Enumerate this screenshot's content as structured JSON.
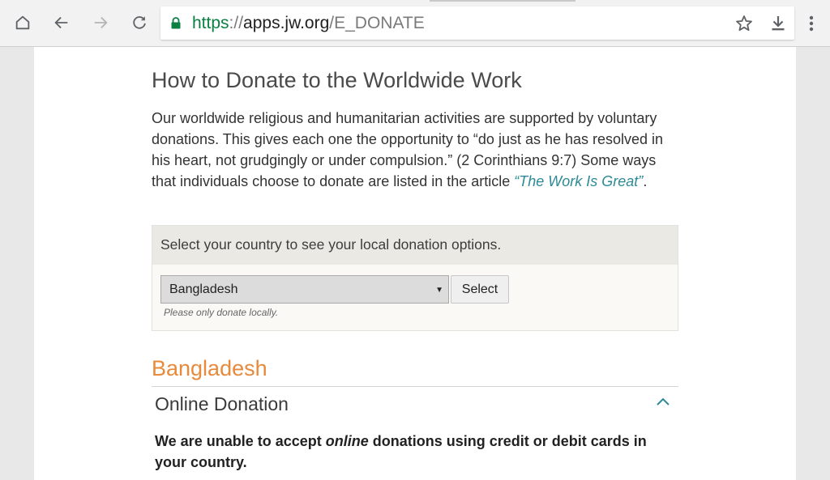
{
  "browser": {
    "url_scheme": "https",
    "url_sep": "://",
    "url_host": "apps.jw.org",
    "url_path": "/E_DONATE"
  },
  "page": {
    "title": "How to Donate to the Worldwide Work",
    "intro_text": "Our worldwide religious and humanitarian activities are supported by voluntary donations. This gives each one the opportunity to “do just as he has resolved in his heart, not grudgingly or under compulsion.” (2 Corinthians 9:7) Some ways that individuals choose to donate are listed in the article ",
    "intro_link": "“The Work Is Great”",
    "intro_end": ".",
    "selector": {
      "heading": "Select your country to see your local donation options.",
      "selected_country": "Bangladesh",
      "button_label": "Select",
      "hint": "Please only donate locally."
    },
    "country_heading": "Bangladesh",
    "accordion": {
      "title": "Online Donation",
      "msg_before": "We are unable to accept ",
      "msg_em": "online",
      "msg_after": " donations using credit or debit cards in your country."
    }
  },
  "colors": {
    "link": "#2d8a96",
    "country_heading": "#e88a3c",
    "secure_scheme": "#0b8043"
  }
}
